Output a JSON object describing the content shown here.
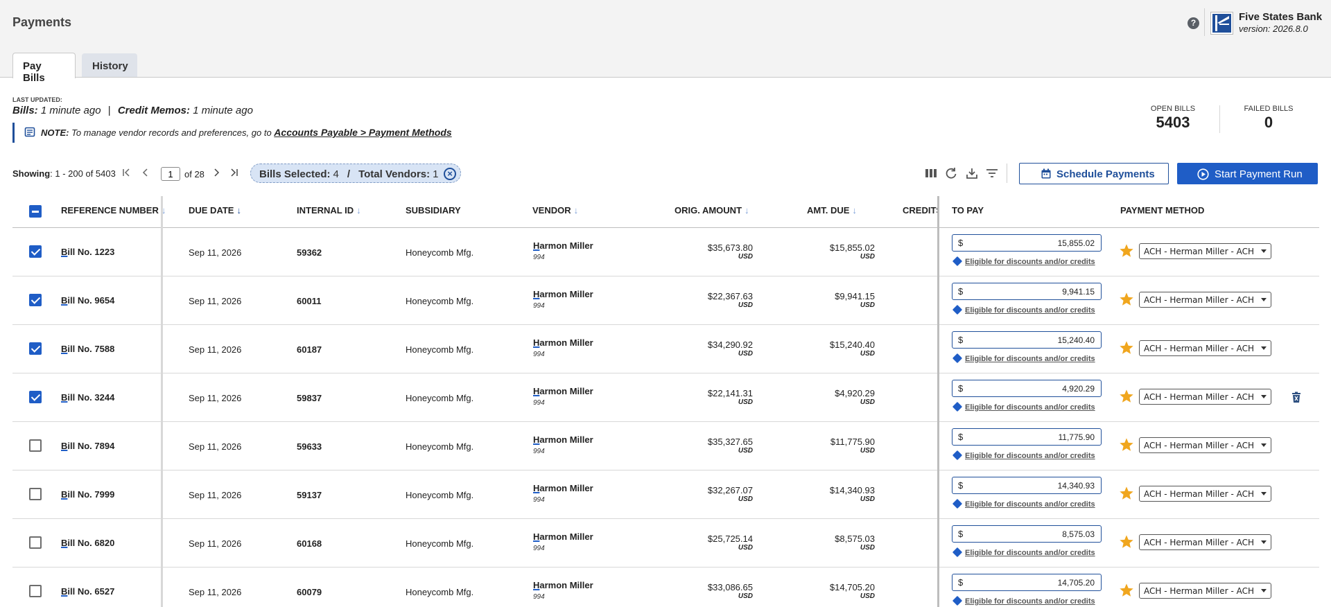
{
  "header": {
    "title": "Payments",
    "help_label": "?",
    "bank_name": "Five States Bank",
    "version": "version: 2026.8.0"
  },
  "tabs": [
    {
      "label": "Pay Bills",
      "active": true
    },
    {
      "label": "History",
      "active": false
    }
  ],
  "updated": {
    "label": "LAST UPDATED:",
    "bills_label": "Bills:",
    "bills_value": "1 minute ago",
    "separator": "|",
    "memos_label": "Credit Memos:",
    "memos_value": "1 minute ago"
  },
  "note": {
    "label": "NOTE:",
    "text": "To manage vendor records and preferences, go to",
    "link": "Accounts Payable > Payment Methods"
  },
  "stats": {
    "open_label": "OPEN BILLS",
    "open_value": "5403",
    "failed_label": "FAILED BILLS",
    "failed_value": "0"
  },
  "pager": {
    "showing_label": "Showing",
    "showing_range": ": 1 - 200 of 5403",
    "page": "1",
    "of_label": "of 28"
  },
  "selection": {
    "bills_label": "Bills Selected:",
    "bills_value": "4",
    "separator": "/",
    "vendors_label": "Total Vendors:",
    "vendors_value": "1"
  },
  "toolbar": {
    "schedule_label": "Schedule Payments",
    "run_label": "Start Payment Run"
  },
  "columns": {
    "reference": "REFERENCE NUMBER",
    "due_date": "DUE DATE",
    "internal_id": "INTERNAL ID",
    "subsidiary": "SUBSIDIARY",
    "vendor": "VENDOR",
    "orig_amount": "ORIG. AMOUNT",
    "amt_due": "AMT. DUE",
    "credits": "CREDITS",
    "to_pay": "TO PAY",
    "payment_method": "PAYMENT METHOD"
  },
  "rows": [
    {
      "bill_prefix": "B",
      "bill_rest": "ill No. 1223",
      "checked": true,
      "due": "Sep 11, 2026",
      "internal_id": "59362",
      "subsidiary": "Honeycomb Mfg.",
      "vendor_first": "H",
      "vendor_rest": "armon Miller",
      "vendor_id": "994",
      "orig": "$35,673.80",
      "orig_cur": "USD",
      "due_amt": "$15,855.02",
      "due_cur": "USD",
      "pay_sign": "$",
      "pay": "15,855.02",
      "discount": "Eligible for discounts and/or credits",
      "method": "ACH - Herman Miller - ACH",
      "trash": false
    },
    {
      "bill_prefix": "B",
      "bill_rest": "ill No. 9654",
      "checked": true,
      "due": "Sep 11, 2026",
      "internal_id": "60011",
      "subsidiary": "Honeycomb Mfg.",
      "vendor_first": "H",
      "vendor_rest": "armon Miller",
      "vendor_id": "994",
      "orig": "$22,367.63",
      "orig_cur": "USD",
      "due_amt": "$9,941.15",
      "due_cur": "USD",
      "pay_sign": "$",
      "pay": "9,941.15",
      "discount": "Eligible for discounts and/or credits",
      "method": "ACH - Herman Miller - ACH",
      "trash": false
    },
    {
      "bill_prefix": "B",
      "bill_rest": "ill No. 7588",
      "checked": true,
      "due": "Sep 11, 2026",
      "internal_id": "60187",
      "subsidiary": "Honeycomb Mfg.",
      "vendor_first": "H",
      "vendor_rest": "armon Miller",
      "vendor_id": "994",
      "orig": "$34,290.92",
      "orig_cur": "USD",
      "due_amt": "$15,240.40",
      "due_cur": "USD",
      "pay_sign": "$",
      "pay": "15,240.40",
      "discount": "Eligible for discounts and/or credits",
      "method": "ACH - Herman Miller - ACH",
      "trash": false
    },
    {
      "bill_prefix": "B",
      "bill_rest": "ill No. 3244",
      "checked": true,
      "due": "Sep 11, 2026",
      "internal_id": "59837",
      "subsidiary": "Honeycomb Mfg.",
      "vendor_first": "H",
      "vendor_rest": "armon Miller",
      "vendor_id": "994",
      "orig": "$22,141.31",
      "orig_cur": "USD",
      "due_amt": "$4,920.29",
      "due_cur": "USD",
      "pay_sign": "$",
      "pay": "4,920.29",
      "discount": "Eligible for discounts and/or credits",
      "method": "ACH - Herman Miller - ACH",
      "trash": true
    },
    {
      "bill_prefix": "B",
      "bill_rest": "ill No. 7894",
      "checked": false,
      "due": "Sep 11, 2026",
      "internal_id": "59633",
      "subsidiary": "Honeycomb Mfg.",
      "vendor_first": "H",
      "vendor_rest": "armon Miller",
      "vendor_id": "994",
      "orig": "$35,327.65",
      "orig_cur": "USD",
      "due_amt": "$11,775.90",
      "due_cur": "USD",
      "pay_sign": "$",
      "pay": "11,775.90",
      "discount": "Eligible for discounts and/or credits",
      "method": "ACH - Herman Miller - ACH",
      "trash": false
    },
    {
      "bill_prefix": "B",
      "bill_rest": "ill No. 7999",
      "checked": false,
      "due": "Sep 11, 2026",
      "internal_id": "59137",
      "subsidiary": "Honeycomb Mfg.",
      "vendor_first": "H",
      "vendor_rest": "armon Miller",
      "vendor_id": "994",
      "orig": "$32,267.07",
      "orig_cur": "USD",
      "due_amt": "$14,340.93",
      "due_cur": "USD",
      "pay_sign": "$",
      "pay": "14,340.93",
      "discount": "Eligible for discounts and/or credits",
      "method": "ACH - Herman Miller - ACH",
      "trash": false
    },
    {
      "bill_prefix": "B",
      "bill_rest": "ill No. 6820",
      "checked": false,
      "due": "Sep 11, 2026",
      "internal_id": "60168",
      "subsidiary": "Honeycomb Mfg.",
      "vendor_first": "H",
      "vendor_rest": "armon Miller",
      "vendor_id": "994",
      "orig": "$25,725.14",
      "orig_cur": "USD",
      "due_amt": "$8,575.03",
      "due_cur": "USD",
      "pay_sign": "$",
      "pay": "8,575.03",
      "discount": "Eligible for discounts and/or credits",
      "method": "ACH - Herman Miller - ACH",
      "trash": false
    },
    {
      "bill_prefix": "B",
      "bill_rest": "ill No. 6527",
      "checked": false,
      "due": "Sep 11, 2026",
      "internal_id": "60079",
      "subsidiary": "Honeycomb Mfg.",
      "vendor_first": "H",
      "vendor_rest": "armon Miller",
      "vendor_id": "994",
      "orig": "$33,086.65",
      "orig_cur": "USD",
      "due_amt": "$14,705.20",
      "due_cur": "USD",
      "pay_sign": "$",
      "pay": "14,705.20",
      "discount": "Eligible for discounts and/or credits",
      "method": "ACH - Herman Miller - ACH",
      "trash": false
    }
  ],
  "colors": {
    "brand_blue": "#1f5dc6",
    "navy": "#1f4f9a",
    "star": "#f0a61e"
  }
}
